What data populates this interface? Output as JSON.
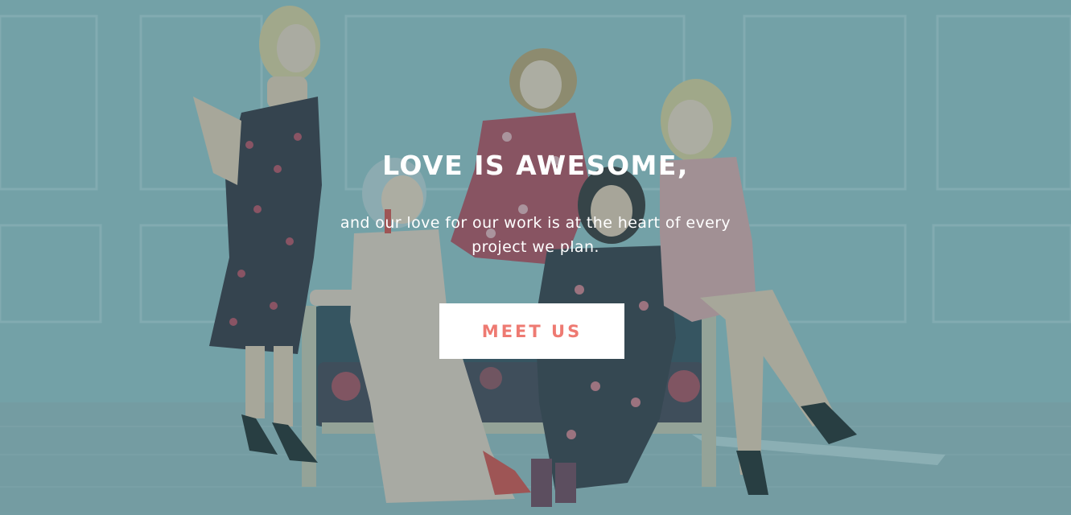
{
  "hero": {
    "headline": "LOVE IS AWESOME,",
    "subline_line1": "and our love for our work is at the heart of every",
    "subline_line2": "project we plan.",
    "cta_label": "MEET US"
  },
  "colors": {
    "overlay": "#4a8a93",
    "cta_background": "#ffffff",
    "cta_text": "#ee7a72",
    "text": "#ffffff"
  }
}
